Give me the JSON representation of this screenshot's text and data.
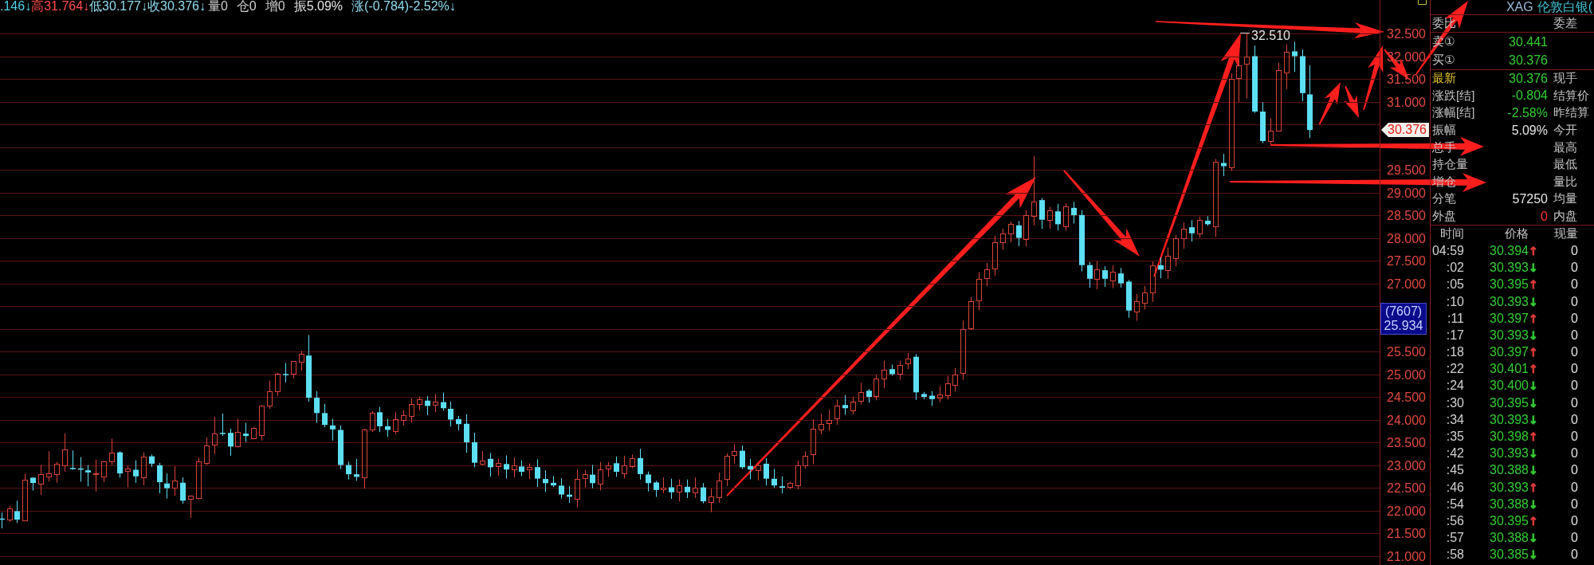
{
  "info_bar": {
    "prices": [
      {
        "text": ".146↓",
        "color": "#4fd0e8"
      },
      {
        "text": "高31.764↓",
        "color": "#ff4c4c"
      },
      {
        "text": "低30.177↓",
        "color": "#8fdcf0"
      },
      {
        "text": "收30.376↓",
        "color": "#8fdcf0"
      }
    ],
    "stats": [
      {
        "text": "量0",
        "color": "#cfcfcf"
      },
      {
        "text": "仓0",
        "color": "#cfcfcf"
      },
      {
        "text": "增0",
        "color": "#cfcfcf"
      },
      {
        "text": "振5.09%",
        "color": "#e6e6e6"
      },
      {
        "text": "涨(-0.784)-2.52%↓",
        "color": "#8fdcf0"
      }
    ]
  },
  "chart": {
    "high_marker": "32.510",
    "price_axis": [
      "32.500",
      "32.000",
      "31.500",
      "31.000",
      "29.500",
      "29.000",
      "28.500",
      "28.000",
      "27.500",
      "27.000",
      "25.500",
      "25.000",
      "24.500",
      "24.000",
      "23.500",
      "23.000",
      "22.500",
      "22.000",
      "21.500",
      "21.000"
    ],
    "last_price_tag": "30.376",
    "cursor_readout": {
      "count": "(7607)",
      "price": "25.934"
    }
  },
  "quote_panel": {
    "symbol": "XAG",
    "name": "伦敦白银(",
    "order_book": {
      "label": "委比",
      "right_label": "委差",
      "rows": [
        {
          "label": "卖①",
          "value": "30.441",
          "color": "#33cc33"
        },
        {
          "label": "买①",
          "value": "30.376",
          "color": "#33cc33"
        }
      ]
    },
    "quote_rows": [
      {
        "label": "最新",
        "highlighted": true,
        "value": "30.376",
        "color": "#33cc33",
        "right_label": "现手"
      },
      {
        "label": "涨跌[结]",
        "highlighted": false,
        "value": "-0.804",
        "color": "#33cc33",
        "right_label": "结算价"
      },
      {
        "label": "涨幅[结]",
        "highlighted": false,
        "value": "-2.58%",
        "color": "#33cc33",
        "right_label": "昨结算"
      },
      {
        "label": "振幅",
        "highlighted": false,
        "value": "5.09%",
        "color": "#e6e6e6",
        "right_label": "今开"
      },
      {
        "label": "总手",
        "highlighted": false,
        "right_label": "最高"
      },
      {
        "label": "持仓量",
        "highlighted": false,
        "right_label": "最低"
      },
      {
        "label": "增仓",
        "highlighted": false,
        "right_label": "量比"
      },
      {
        "label": "分笔",
        "highlighted": false,
        "value": "57250",
        "color": "#e6e6e6",
        "right_label": "均量"
      },
      {
        "label": "外盘",
        "highlighted": false,
        "value": "0",
        "color": "#ff3333",
        "right_label": "内盘"
      }
    ],
    "trade_columns": [
      "时间",
      "价格",
      "现量"
    ],
    "trades": [
      {
        "time": "04:59",
        "price": "30.394",
        "arrow": "↑",
        "color": "#e23b3b",
        "volume": "0"
      },
      {
        "time": ":02",
        "price": "30.393",
        "arrow": "↓",
        "color": "#33cc33",
        "volume": "0"
      },
      {
        "time": ":05",
        "price": "30.395",
        "arrow": "↑",
        "color": "#e23b3b",
        "volume": "0"
      },
      {
        "time": ":10",
        "price": "30.393",
        "arrow": "↓",
        "color": "#33cc33",
        "volume": "0"
      },
      {
        "time": ":11",
        "price": "30.397",
        "arrow": "↑",
        "color": "#e23b3b",
        "volume": "0"
      },
      {
        "time": ":17",
        "price": "30.393",
        "arrow": "↓",
        "color": "#33cc33",
        "volume": "0"
      },
      {
        "time": ":18",
        "price": "30.397",
        "arrow": "↑",
        "color": "#e23b3b",
        "volume": "0"
      },
      {
        "time": ":22",
        "price": "30.401",
        "arrow": "↑",
        "color": "#e23b3b",
        "volume": "0"
      },
      {
        "time": ":24",
        "price": "30.400",
        "arrow": "↓",
        "color": "#33cc33",
        "volume": "0"
      },
      {
        "time": ":30",
        "price": "30.395",
        "arrow": "↓",
        "color": "#33cc33",
        "volume": "0"
      },
      {
        "time": ":34",
        "price": "30.393",
        "arrow": "↓",
        "color": "#33cc33",
        "volume": "0"
      },
      {
        "time": ":35",
        "price": "30.398",
        "arrow": "↑",
        "color": "#e23b3b",
        "volume": "0"
      },
      {
        "time": ":42",
        "price": "30.393",
        "arrow": "↓",
        "color": "#33cc33",
        "volume": "0"
      },
      {
        "time": ":45",
        "price": "30.388",
        "arrow": "↓",
        "color": "#33cc33",
        "volume": "0"
      },
      {
        "time": ":46",
        "price": "30.393",
        "arrow": "↑",
        "color": "#e23b3b",
        "volume": "0"
      },
      {
        "time": ":54",
        "price": "30.388",
        "arrow": "↓",
        "color": "#33cc33",
        "volume": "0"
      },
      {
        "time": ":56",
        "price": "30.395",
        "arrow": "↑",
        "color": "#e23b3b",
        "volume": "0"
      },
      {
        "time": ":57",
        "price": "30.388",
        "arrow": "↓",
        "color": "#33cc33",
        "volume": "0"
      },
      {
        "time": ":58",
        "price": "30.385",
        "arrow": "↓",
        "color": "#33cc33",
        "volume": "0"
      }
    ]
  }
}
